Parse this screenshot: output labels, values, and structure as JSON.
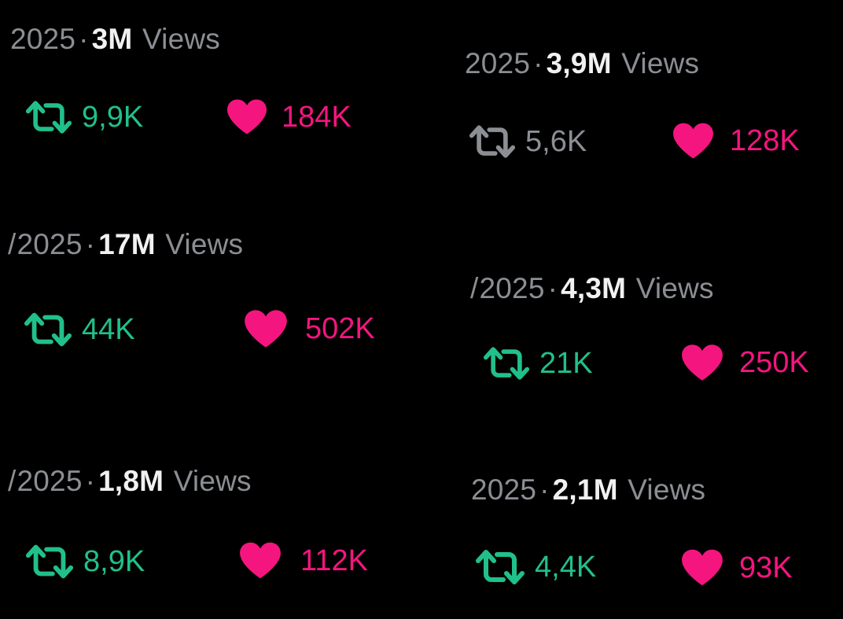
{
  "colors": {
    "background": "#000000",
    "meta_text": "#8b8e93",
    "view_count": "#f1f1f1",
    "retweet_active": "#21c08b",
    "retweet_inactive": "#8b8e93",
    "like": "#f5157f"
  },
  "icons": {
    "retweet": "retweet-icon",
    "like": "heart-icon"
  },
  "separator": "·",
  "views_label": "Views",
  "posts": [
    {
      "year": "2025",
      "views": "3M",
      "retweets": "9,9K",
      "likes": "184K",
      "retweeted": true,
      "leading_mark": ""
    },
    {
      "year": "2025",
      "views": "3,9M",
      "retweets": "5,6K",
      "likes": "128K",
      "retweeted": false,
      "leading_mark": ""
    },
    {
      "year": "2025",
      "views": "17M",
      "retweets": "44K",
      "likes": "502K",
      "retweeted": true,
      "leading_mark": "/"
    },
    {
      "year": "2025",
      "views": "4,3M",
      "retweets": "21K",
      "likes": "250K",
      "retweeted": true,
      "leading_mark": "/"
    },
    {
      "year": "2025",
      "views": "1,8M",
      "retweets": "8,9K",
      "likes": "112K",
      "retweeted": true,
      "leading_mark": "/"
    },
    {
      "year": "2025",
      "views": "2,1M",
      "retweets": "4,4K",
      "likes": "93K",
      "retweeted": true,
      "leading_mark": ""
    }
  ]
}
